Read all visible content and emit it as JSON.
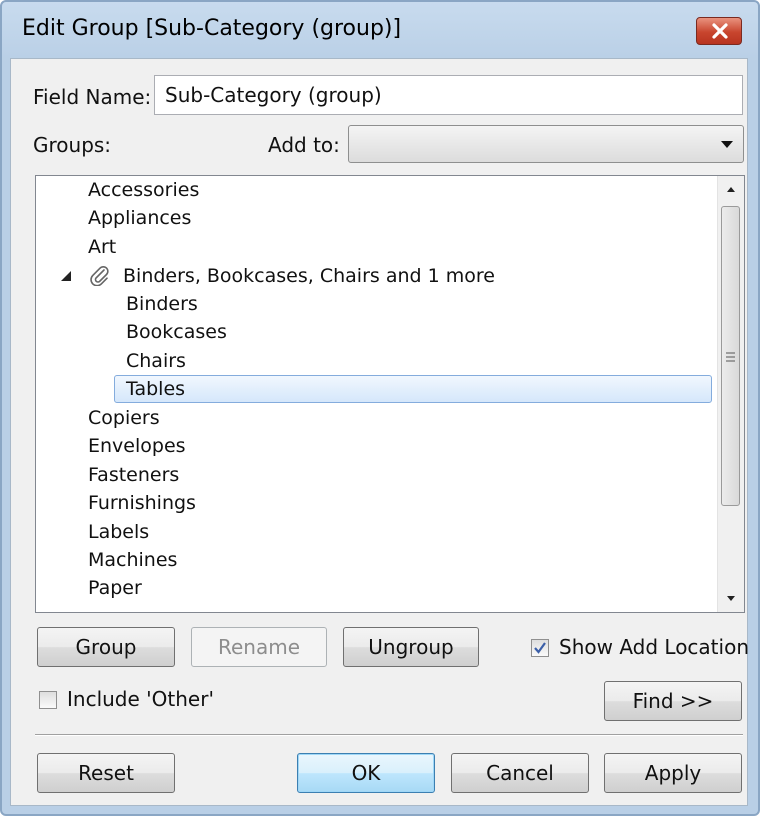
{
  "window": {
    "title": "Edit Group [Sub-Category (group)]"
  },
  "form": {
    "field_name_label": "Field Name:",
    "field_name_value": "Sub-Category (group)",
    "groups_label": "Groups:",
    "add_to_label": "Add to:",
    "add_to_value": ""
  },
  "tree": {
    "items": [
      {
        "label": "Accessories",
        "level": 0
      },
      {
        "label": "Appliances",
        "level": 0
      },
      {
        "label": "Art",
        "level": 0
      },
      {
        "label": "Binders, Bookcases, Chairs and 1 more",
        "level": 0,
        "expanded": true,
        "icon": "paperclip-icon"
      },
      {
        "label": "Binders",
        "level": 1
      },
      {
        "label": "Bookcases",
        "level": 1
      },
      {
        "label": "Chairs",
        "level": 1
      },
      {
        "label": "Tables",
        "level": 1,
        "selected": true
      },
      {
        "label": "Copiers",
        "level": 0
      },
      {
        "label": "Envelopes",
        "level": 0
      },
      {
        "label": "Fasteners",
        "level": 0
      },
      {
        "label": "Furnishings",
        "level": 0
      },
      {
        "label": "Labels",
        "level": 0
      },
      {
        "label": "Machines",
        "level": 0
      },
      {
        "label": "Paper",
        "level": 0
      }
    ]
  },
  "buttons": {
    "group": "Group",
    "rename": "Rename",
    "ungroup": "Ungroup",
    "find": "Find >>",
    "reset": "Reset",
    "ok": "OK",
    "cancel": "Cancel",
    "apply": "Apply"
  },
  "checkboxes": {
    "show_add_location": {
      "label": "Show Add Location",
      "checked": true
    },
    "include_other": {
      "label": "Include 'Other'",
      "checked": false
    }
  },
  "colors": {
    "selection_border": "#84acdd",
    "close_button": "#c8452e",
    "check_mark": "#3b5fa8"
  }
}
